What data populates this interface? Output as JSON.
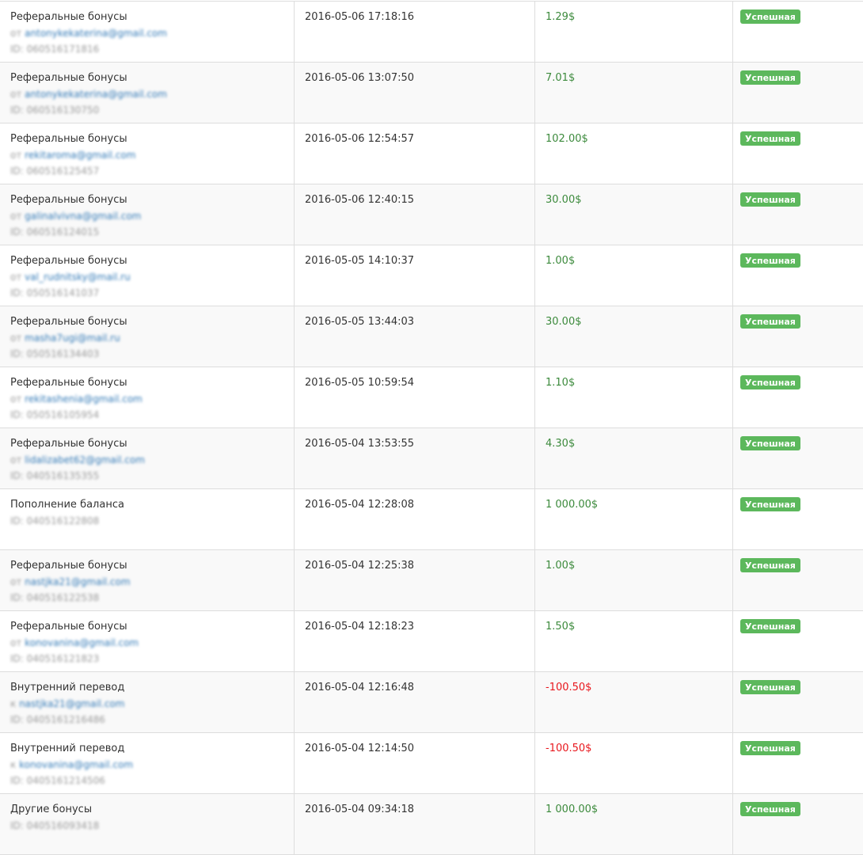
{
  "rows": [
    {
      "type": "Реферальные бонусы",
      "prefix": "от",
      "email": "antonykekaterina@gmail.com",
      "id": "ID: 060516171816",
      "date": "2016-05-06 17:18:16",
      "amount": "1.29$",
      "negative": false,
      "status": "Успешная"
    },
    {
      "type": "Реферальные бонусы",
      "prefix": "от",
      "email": "antonykekaterina@gmail.com",
      "id": "ID: 060516130750",
      "date": "2016-05-06 13:07:50",
      "amount": "7.01$",
      "negative": false,
      "status": "Успешная"
    },
    {
      "type": "Реферальные бонусы",
      "prefix": "от",
      "email": "rekitaroma@gmail.com",
      "id": "ID: 060516125457",
      "date": "2016-05-06 12:54:57",
      "amount": "102.00$",
      "negative": false,
      "status": "Успешная"
    },
    {
      "type": "Реферальные бонусы",
      "prefix": "от",
      "email": "galinalvivna@gmail.com",
      "id": "ID: 060516124015",
      "date": "2016-05-06 12:40:15",
      "amount": "30.00$",
      "negative": false,
      "status": "Успешная"
    },
    {
      "type": "Реферальные бонусы",
      "prefix": "от",
      "email": "val_rudnitsky@mail.ru",
      "id": "ID: 050516141037",
      "date": "2016-05-05 14:10:37",
      "amount": "1.00$",
      "negative": false,
      "status": "Успешная"
    },
    {
      "type": "Реферальные бонусы",
      "prefix": "от",
      "email": "masha7ugi@mail.ru",
      "id": "ID: 050516134403",
      "date": "2016-05-05 13:44:03",
      "amount": "30.00$",
      "negative": false,
      "status": "Успешная"
    },
    {
      "type": "Реферальные бонусы",
      "prefix": "от",
      "email": "rekitashenia@gmail.com",
      "id": "ID: 050516105954",
      "date": "2016-05-05 10:59:54",
      "amount": "1.10$",
      "negative": false,
      "status": "Успешная"
    },
    {
      "type": "Реферальные бонусы",
      "prefix": "от",
      "email": "lidalizabet62@gmail.com",
      "id": "ID: 040516135355",
      "date": "2016-05-04 13:53:55",
      "amount": "4.30$",
      "negative": false,
      "status": "Успешная"
    },
    {
      "type": "Пополнение баланса",
      "prefix": "",
      "email": "",
      "id": "ID: 040516122808",
      "date": "2016-05-04 12:28:08",
      "amount": "1 000.00$",
      "negative": false,
      "status": "Успешная"
    },
    {
      "type": "Реферальные бонусы",
      "prefix": "от",
      "email": "nastjka21@gmail.com",
      "id": "ID: 040516122538",
      "date": "2016-05-04 12:25:38",
      "amount": "1.00$",
      "negative": false,
      "status": "Успешная"
    },
    {
      "type": "Реферальные бонусы",
      "prefix": "от",
      "email": "konovanina@gmail.com",
      "id": "ID: 040516121823",
      "date": "2016-05-04 12:18:23",
      "amount": "1.50$",
      "negative": false,
      "status": "Успешная"
    },
    {
      "type": "Внутренний перевод",
      "prefix": "к",
      "email": "nastjka21@gmail.com",
      "id": "ID: 0405161216486",
      "date": "2016-05-04 12:16:48",
      "amount": "-100.50$",
      "negative": true,
      "status": "Успешная"
    },
    {
      "type": "Внутренний перевод",
      "prefix": "к",
      "email": "konovanina@gmail.com",
      "id": "ID: 0405161214506",
      "date": "2016-05-04 12:14:50",
      "amount": "-100.50$",
      "negative": true,
      "status": "Успешная"
    },
    {
      "type": "Другие бонусы",
      "prefix": "",
      "email": "",
      "id": "ID: 040516093418",
      "date": "2016-05-04 09:34:18",
      "amount": "1 000.00$",
      "negative": false,
      "status": "Успешная"
    }
  ],
  "colors": {
    "success": "#5cb85c",
    "positive": "#3c8a3c",
    "negative": "#e8171d",
    "link": "#337ab7"
  }
}
